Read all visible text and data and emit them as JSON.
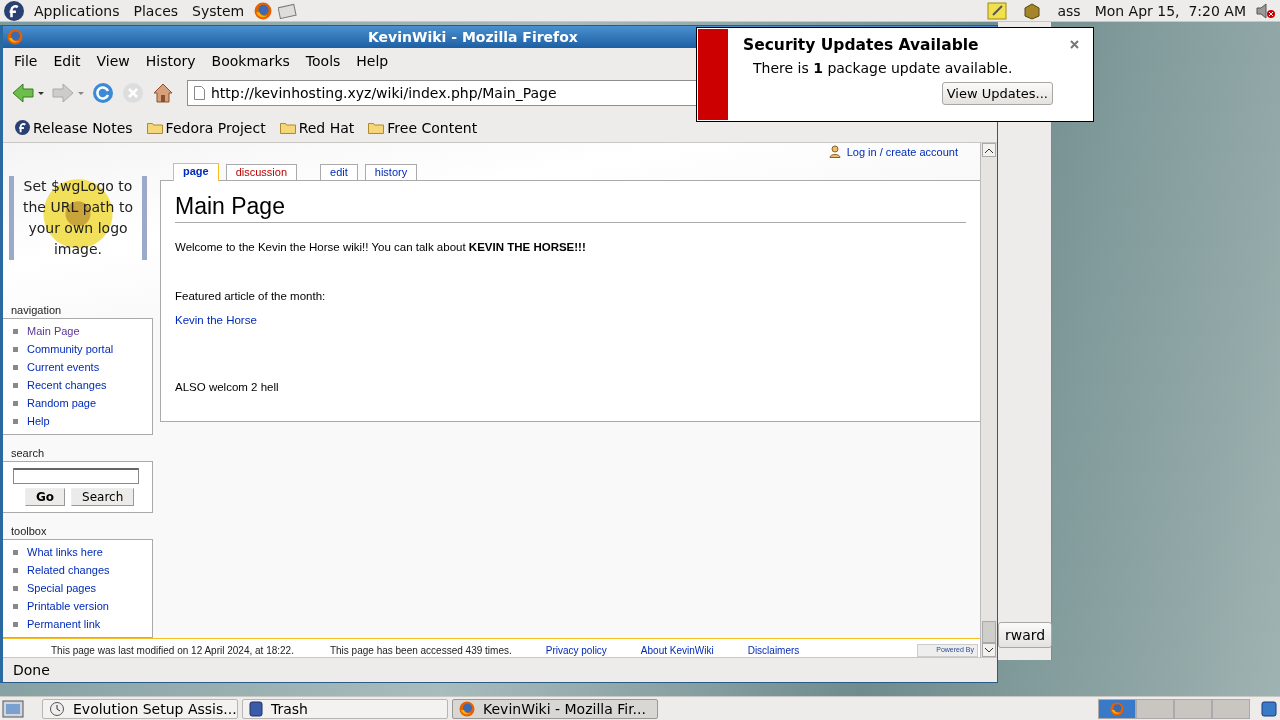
{
  "top_panel": {
    "menus": [
      "Applications",
      "Places",
      "System"
    ],
    "user": "ass",
    "clock": "Mon Apr 15,  7:20 AM"
  },
  "background_window": {
    "button": "rward"
  },
  "browser": {
    "title": "KevinWiki - Mozilla Firefox",
    "menu": [
      "File",
      "Edit",
      "View",
      "History",
      "Bookmarks",
      "Tools",
      "Help"
    ],
    "url": "http://kevinhosting.xyz/wiki/index.php/Main_Page",
    "bookmarks": [
      {
        "label": "Release Notes",
        "kind": "fedora"
      },
      {
        "label": "Fedora Project",
        "kind": "folder"
      },
      {
        "label": "Red Hat",
        "kind": "folder"
      },
      {
        "label": "Free Content",
        "kind": "folder"
      }
    ],
    "status": "Done"
  },
  "wiki": {
    "logo_text": "Set $wgLogo to the URL path to your own logo image.",
    "personal": "Log in / create account",
    "navigation": {
      "title": "navigation",
      "items": [
        {
          "label": "Main Page",
          "visited": true
        },
        {
          "label": "Community portal",
          "visited": false
        },
        {
          "label": "Current events",
          "visited": false
        },
        {
          "label": "Recent changes",
          "visited": false
        },
        {
          "label": "Random page",
          "visited": false
        },
        {
          "label": "Help",
          "visited": false
        }
      ]
    },
    "search": {
      "title": "search",
      "buttons": [
        "Go",
        "Search"
      ]
    },
    "toolbox": {
      "title": "toolbox",
      "items": [
        {
          "label": "What links here",
          "visited": false
        },
        {
          "label": "Related changes",
          "visited": false
        },
        {
          "label": "Special pages",
          "visited": false
        },
        {
          "label": "Printable version",
          "visited": false
        },
        {
          "label": "Permanent link",
          "visited": false
        }
      ]
    },
    "tabs": [
      {
        "label": "page",
        "selected": true,
        "kind": "existing"
      },
      {
        "label": "discussion",
        "selected": false,
        "kind": "new"
      },
      {
        "label": "edit",
        "selected": false,
        "kind": "existing"
      },
      {
        "label": "history",
        "selected": false,
        "kind": "existing"
      }
    ],
    "heading": "Main Page",
    "paragraphs": [
      {
        "kind": "text",
        "text": "Welcome to the Kevin the Horse wiki!! You can talk about **KEVIN THE HORSE!!!**"
      },
      {
        "kind": "text",
        "text": "Featured article of the month:"
      },
      {
        "kind": "link",
        "text": "Kevin the Horse"
      },
      {
        "kind": "text",
        "text": "ALSO welcom 2 hell"
      }
    ],
    "footer": {
      "texts": [
        "This page was last modified on 12 April 2024, at 18:22.",
        "This page has been accessed 439 times."
      ],
      "links": [
        "Privacy policy",
        "About KevinWiki",
        "Disclaimers"
      ],
      "badge": "Powered By"
    }
  },
  "notification": {
    "title": "Security Updates Available",
    "message": "There is **1** package update available.",
    "button": "View Updates..."
  },
  "taskbar": {
    "items": [
      {
        "label": "Evolution Setup Assis...",
        "selected": false,
        "kind": "evolution"
      },
      {
        "label": "Trash",
        "selected": false,
        "kind": "trash"
      },
      {
        "label": "KevinWiki - Mozilla Fir...",
        "selected": true,
        "kind": "firefox"
      }
    ],
    "workspaces": [
      {
        "selected": true
      },
      {
        "selected": false
      },
      {
        "selected": false
      },
      {
        "selected": false
      }
    ]
  }
}
